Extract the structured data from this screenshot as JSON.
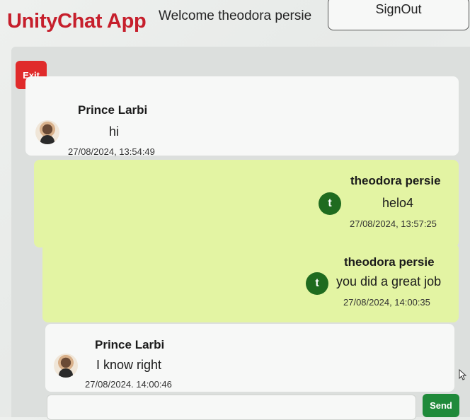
{
  "header": {
    "app_title": "UnityChat App",
    "welcome_text": "Welcome theodora persie",
    "signout_label": "SignOut"
  },
  "chat": {
    "exit_label": "Exit",
    "messages": [
      {
        "sender": "Prince Larbi",
        "text": "hi",
        "time": "27/08/2024, 13:54:49",
        "avatar": "photo"
      },
      {
        "sender": "theodora persie",
        "text": "helo4",
        "time": "27/08/2024, 13:57:25",
        "avatar_initial": "t"
      },
      {
        "sender": "theodora persie",
        "text": "you did a great job",
        "time": "27/08/2024, 14:00:35",
        "avatar_initial": "t"
      },
      {
        "sender": "Prince Larbi",
        "text": "I know right",
        "time": "27/08/2024. 14:00:46",
        "avatar": "photo"
      }
    ],
    "send_label": "Send"
  },
  "colors": {
    "brand": "#c61f2c",
    "exit": "#e02b2b",
    "sent_bubble": "#e3f4a3",
    "received_bubble": "#f7f8f7",
    "avatar_initial_bg": "#1f6b1f",
    "send": "#1f8a3a"
  },
  "icons": {
    "cursor": "pointer-arrow-icon"
  }
}
